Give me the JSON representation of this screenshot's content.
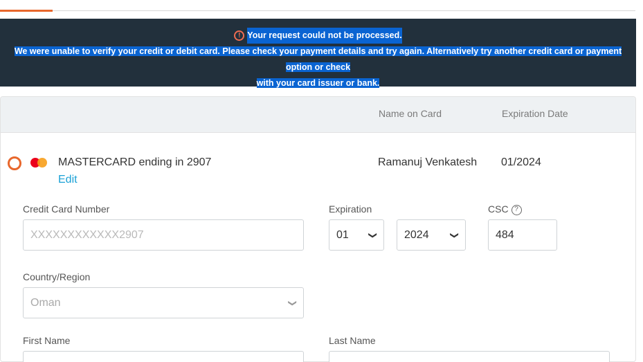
{
  "error": {
    "title": "Your request could not be processed.",
    "message_line1": "We were unable to verify your credit or debit card. Please check your payment details and try again. Alternatively try another credit card or payment option or check",
    "message_line2": "with your card issuer or bank."
  },
  "table": {
    "headers": {
      "name_on_card": "Name on Card",
      "expiration_date": "Expiration Date"
    },
    "row": {
      "card_label": "MASTERCARD ending in 2907",
      "edit_label": "Edit",
      "name_on_card": "Ramanuj Venkatesh",
      "expiration_date": "01/2024"
    }
  },
  "form": {
    "credit_card_number": {
      "label": "Credit Card Number",
      "placeholder": "XXXXXXXXXXXX2907"
    },
    "expiration": {
      "label": "Expiration",
      "month": "01",
      "year": "2024"
    },
    "csc": {
      "label": "CSC",
      "value": "484"
    },
    "country": {
      "label": "Country/Region",
      "value": "Oman"
    },
    "first_name": {
      "label": "First Name"
    },
    "last_name": {
      "label": "Last Name"
    }
  },
  "colors": {
    "accent": "#e8672c",
    "banner_bg": "#22303c",
    "link": "#1aa1d6"
  }
}
